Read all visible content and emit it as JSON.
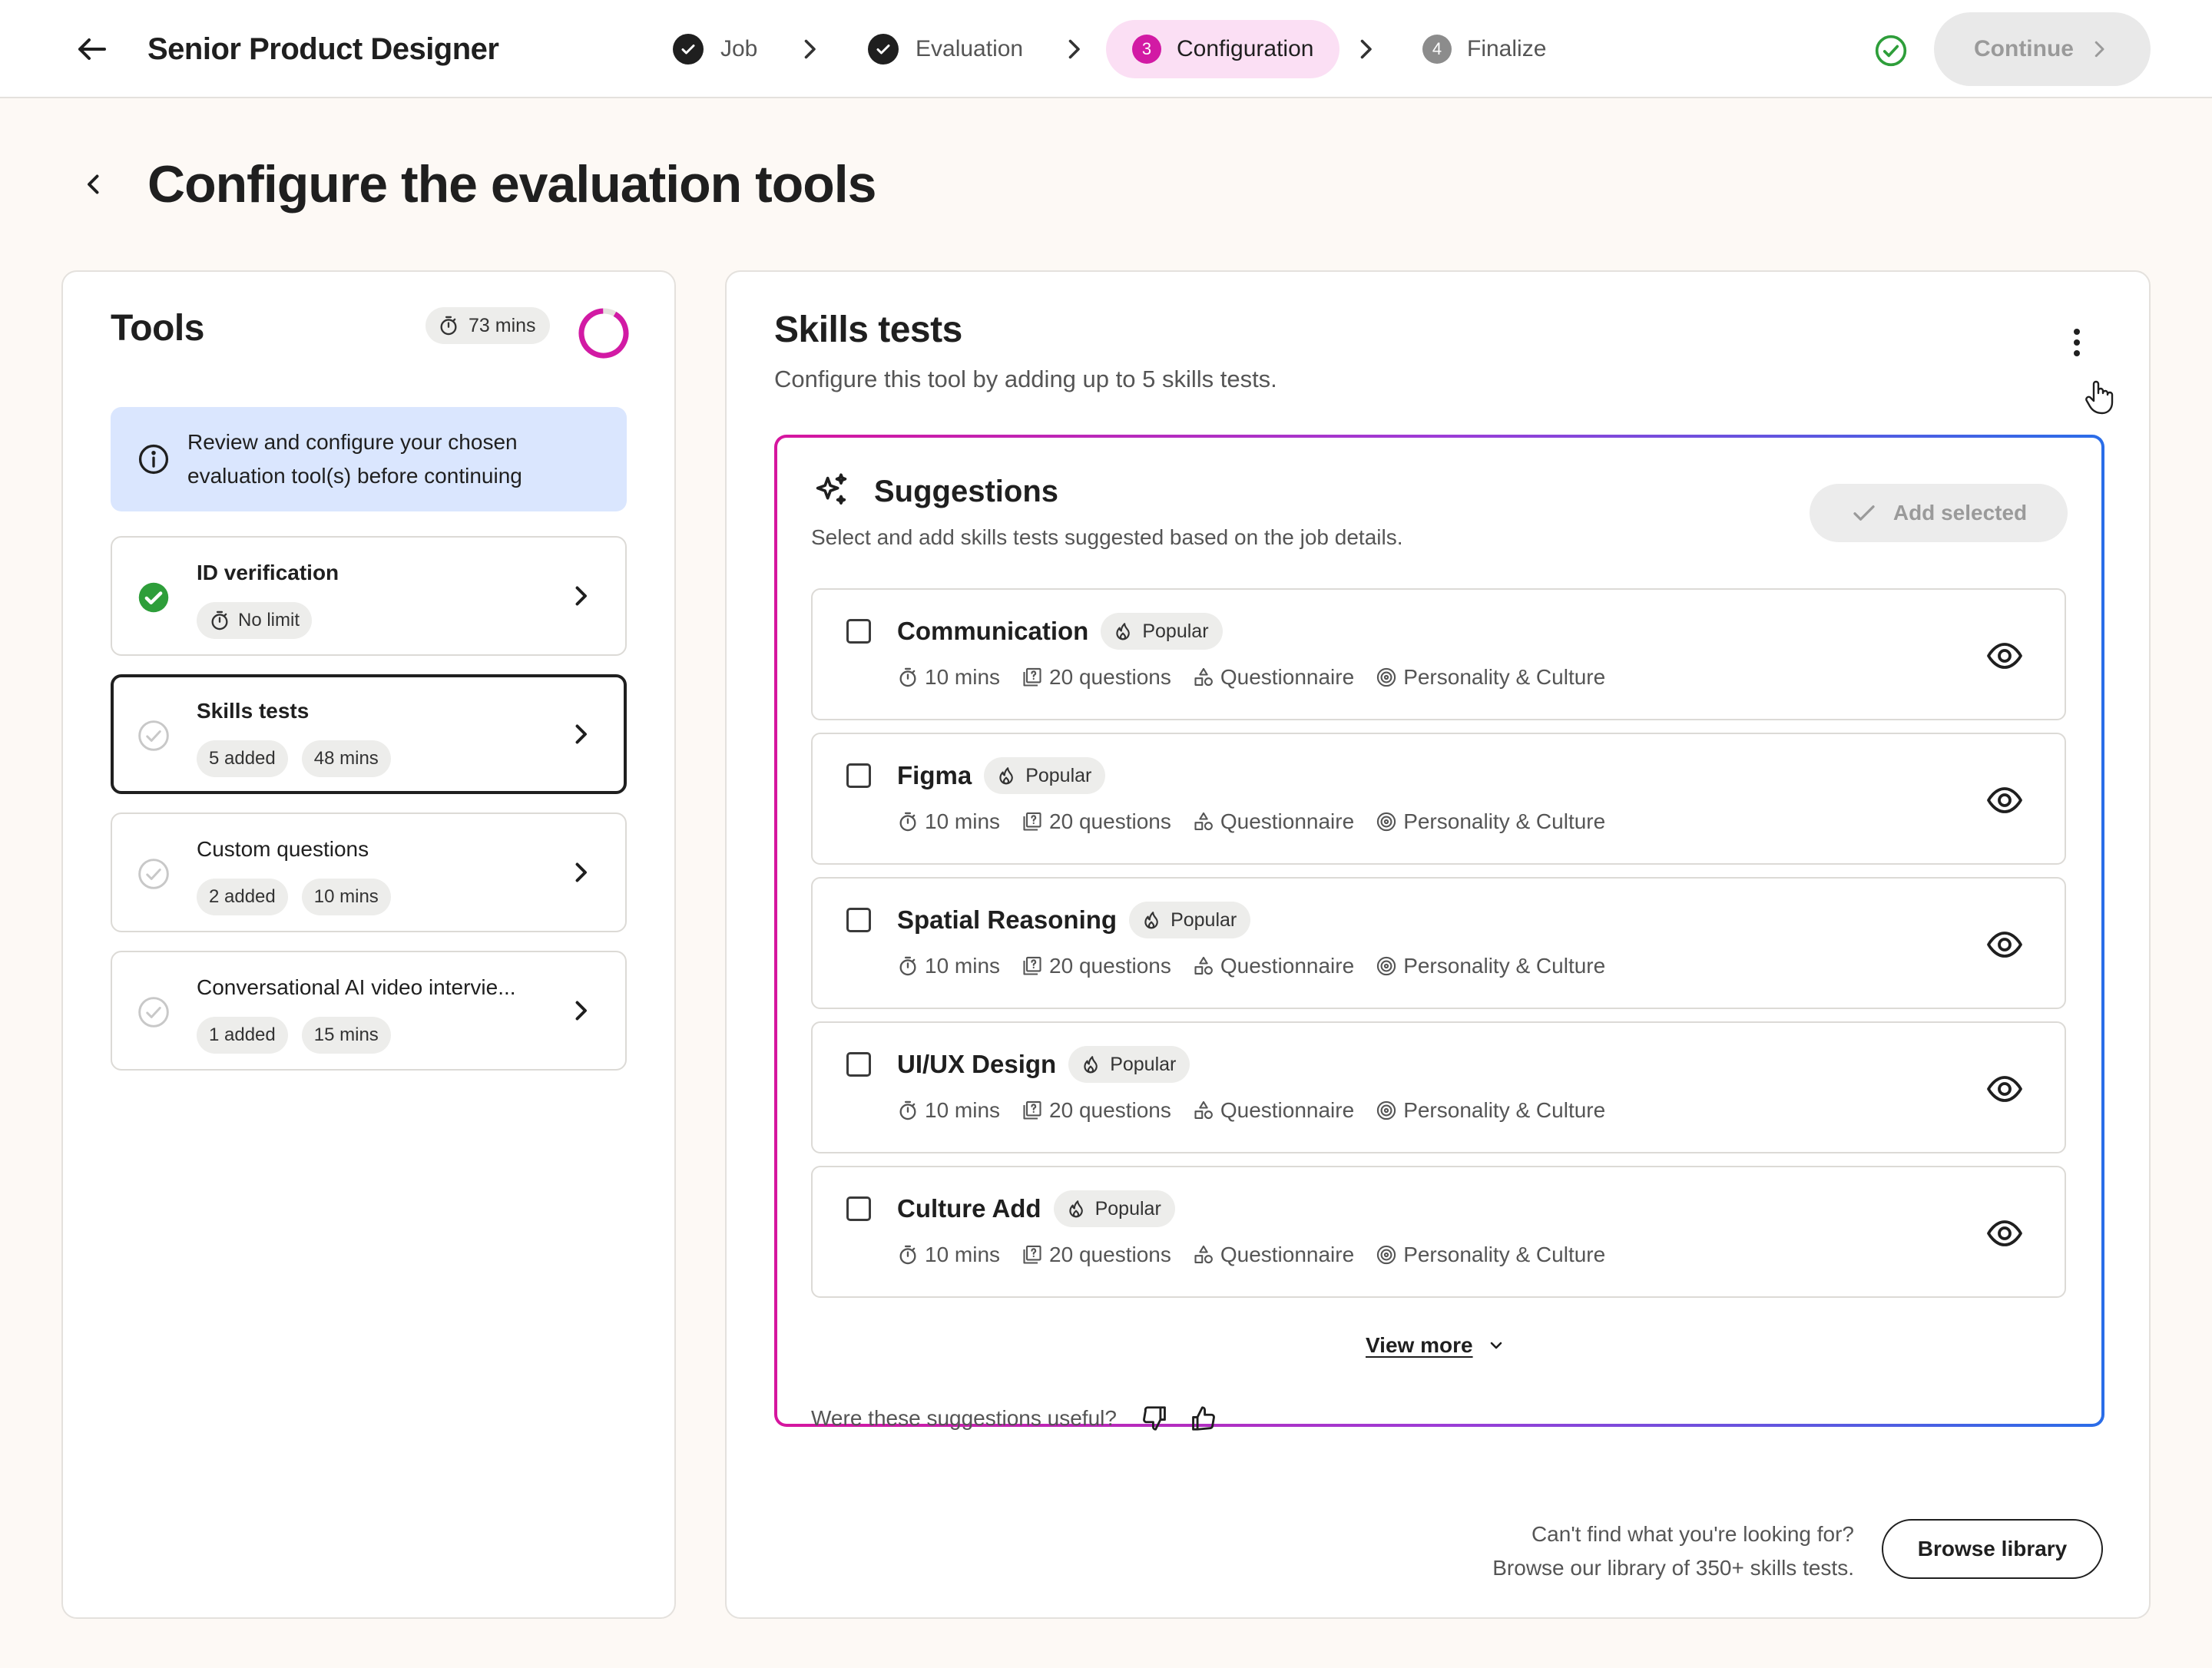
{
  "header": {
    "job_title": "Senior Product Designer",
    "steps": [
      {
        "label": "Job",
        "state": "done"
      },
      {
        "label": "Evaluation",
        "state": "done"
      },
      {
        "label": "Configuration",
        "state": "active",
        "number": "3"
      },
      {
        "label": "Finalize",
        "state": "pending",
        "number": "4"
      }
    ],
    "continue_label": "Continue"
  },
  "page": {
    "title": "Configure the evaluation tools"
  },
  "tools": {
    "title": "Tools",
    "total_time": "73 mins",
    "info": "Review and configure your chosen evaluation tool(s) before continuing",
    "items": [
      {
        "name": "ID verification",
        "tags": [
          "No limit"
        ],
        "status": "complete"
      },
      {
        "name": "Skills tests",
        "tags": [
          "5 added",
          "48 mins"
        ],
        "status": "incomplete"
      },
      {
        "name": "Custom questions",
        "tags": [
          "2 added",
          "10 mins"
        ],
        "status": "incomplete"
      },
      {
        "name": "Conversational AI video intervie...",
        "tags": [
          "1 added",
          "15 mins"
        ],
        "status": "incomplete"
      }
    ]
  },
  "skills": {
    "title": "Skills tests",
    "subtitle": "Configure this tool by adding up to 5 skills tests.",
    "suggestions": {
      "title": "Suggestions",
      "subtitle": "Select and add skills tests suggested based on the job details.",
      "add_selected": "Add selected",
      "badge": "Popular",
      "tests": [
        {
          "name": "Communication",
          "duration": "10 mins",
          "questions": "20 questions",
          "format": "Questionnaire",
          "category": "Personality & Culture"
        },
        {
          "name": "Figma",
          "duration": "10 mins",
          "questions": "20 questions",
          "format": "Questionnaire",
          "category": "Personality & Culture"
        },
        {
          "name": "Spatial Reasoning",
          "duration": "10 mins",
          "questions": "20 questions",
          "format": "Questionnaire",
          "category": "Personality & Culture"
        },
        {
          "name": "UI/UX Design",
          "duration": "10 mins",
          "questions": "20 questions",
          "format": "Questionnaire",
          "category": "Personality & Culture"
        },
        {
          "name": "Culture Add",
          "duration": "10 mins",
          "questions": "20 questions",
          "format": "Questionnaire",
          "category": "Personality & Culture"
        }
      ],
      "view_more": "View more",
      "feedback": "Were these suggestions useful?"
    },
    "library_line1": "Can't find what you're looking for?",
    "library_line2": "Browse our library of 350+ skills tests.",
    "browse_label": "Browse library"
  },
  "colors": {
    "accent_magenta": "#d21aa4",
    "accent_blue": "#2a6de8",
    "success_green": "#2e9e3a",
    "info_bg": "#dae6fe",
    "page_bg": "#fdf9f5"
  }
}
